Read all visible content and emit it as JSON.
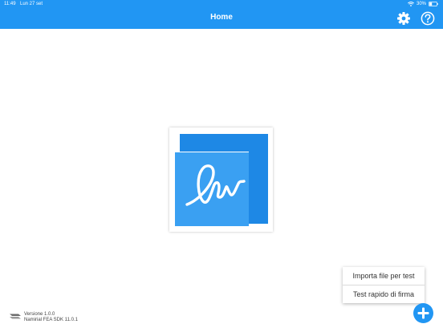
{
  "status_bar": {
    "time": "11:49",
    "date": "Lun 27 set",
    "battery": "30%"
  },
  "navbar": {
    "title": "Home",
    "color": "#2196f3",
    "icons": [
      "gear-icon",
      "help-icon"
    ]
  },
  "logo": {
    "icon": "signature-logo-icon",
    "colors": [
      "#1e88e5",
      "#42a5f5"
    ]
  },
  "menu": {
    "items": [
      {
        "label": "Importa file per test"
      },
      {
        "label": "Test rapido di firma"
      }
    ]
  },
  "fab": {
    "icon": "plus-icon",
    "color": "#2196f3"
  },
  "footer": {
    "version_line": "Versione 1.0.0",
    "sdk_line": "Namirial FEA SDK 11.0.1",
    "logo_icon": "namirial-logo-icon"
  }
}
